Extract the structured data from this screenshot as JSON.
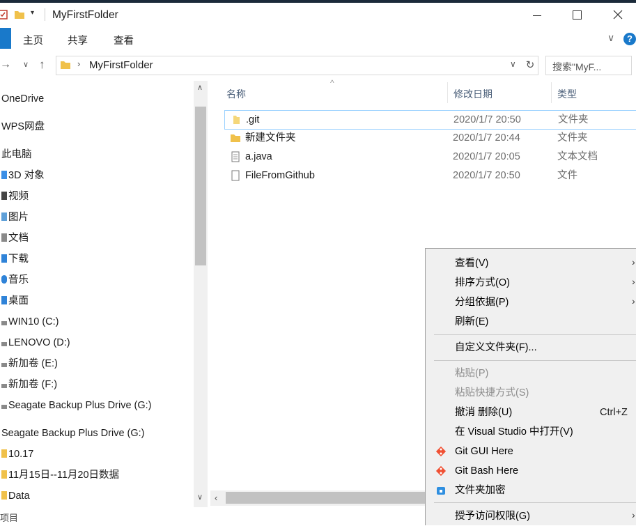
{
  "window": {
    "title": "MyFirstFolder",
    "controls": [
      "minimize",
      "maximize",
      "close"
    ]
  },
  "ribbon": {
    "tabs": [
      "主页",
      "共享",
      "查看"
    ]
  },
  "address": {
    "path": "MyFirstFolder",
    "search_placeholder": "搜索\"MyF..."
  },
  "sidebar": {
    "items": [
      {
        "label": "OneDrive"
      },
      {
        "label": "WPS网盘"
      },
      {
        "label": "此电脑"
      },
      {
        "label": "3D 对象"
      },
      {
        "label": "视频"
      },
      {
        "label": "图片"
      },
      {
        "label": "文档"
      },
      {
        "label": "下载"
      },
      {
        "label": "音乐"
      },
      {
        "label": "桌面"
      },
      {
        "label": "WIN10 (C:)"
      },
      {
        "label": "LENOVO (D:)"
      },
      {
        "label": "新加卷 (E:)"
      },
      {
        "label": "新加卷 (F:)"
      },
      {
        "label": "Seagate Backup Plus Drive (G:)"
      },
      {
        "label": "Seagate Backup Plus Drive (G:)"
      },
      {
        "label": "10.17"
      },
      {
        "label": "11月15日--11月20日数据"
      },
      {
        "label": "Data"
      }
    ],
    "footer_label": "项目"
  },
  "columns": {
    "name": "名称",
    "date": "修改日期",
    "type": "类型"
  },
  "files": [
    {
      "name": ".git",
      "date": "2020/1/7 20:50",
      "type": "文件夹",
      "icon": "folder-icon"
    },
    {
      "name": "新建文件夹",
      "date": "2020/1/7 20:44",
      "type": "文件夹",
      "icon": "folder-icon"
    },
    {
      "name": "a.java",
      "date": "2020/1/7 20:05",
      "type": "文本文档",
      "icon": "text-file-icon"
    },
    {
      "name": "FileFromGithub",
      "date": "2020/1/7 20:50",
      "type": "文件",
      "icon": "file-icon"
    }
  ],
  "context_menu": {
    "view": "查看(V)",
    "sort": "排序方式(O)",
    "group": "分组依据(P)",
    "refresh": "刷新(E)",
    "customize": "自定义文件夹(F)...",
    "paste": "粘贴(P)",
    "paste_shortcut": "粘贴快捷方式(S)",
    "undo": "撤消 删除(U)",
    "undo_shortcut": "Ctrl+Z",
    "open_vs": "在 Visual Studio 中打开(V)",
    "git_gui": "Git GUI Here",
    "git_bash": "Git Bash Here",
    "encrypt": "文件夹加密",
    "grant_access": "授予访问权限(G)"
  },
  "colors": {
    "accent": "#0078d7",
    "folder": "#f0c14b",
    "git": "#f05033"
  }
}
